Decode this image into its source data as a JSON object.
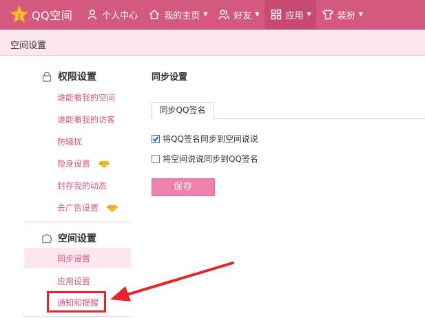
{
  "topbar": {
    "brand": "QQ空间",
    "nav": [
      {
        "label": "个人中心",
        "icon": "person-icon",
        "has_caret": false
      },
      {
        "label": "我的主页",
        "icon": "home-icon",
        "has_caret": true
      },
      {
        "label": "好友",
        "icon": "friends-icon",
        "has_caret": true
      },
      {
        "label": "应用",
        "icon": "apps-grid-icon",
        "has_caret": true,
        "active": true
      },
      {
        "label": "装扮",
        "icon": "tshirt-icon",
        "has_caret": true
      }
    ],
    "caret": "▼"
  },
  "page_header": {
    "title": "空间设置"
  },
  "sidebar": {
    "permissions": {
      "title": "权限设置",
      "icon": "lock-icon",
      "items": [
        {
          "label": "谁能看我的空间"
        },
        {
          "label": "谁能看我的访客"
        },
        {
          "label": "防骚扰"
        },
        {
          "label": "隐身设置",
          "vip_icon": "diamond-icon"
        },
        {
          "label": "封存我的动态"
        },
        {
          "label": "去广告设置",
          "vip_icon": "diamond-icon"
        }
      ]
    },
    "space": {
      "title": "空间设置",
      "icon": "puzzle-icon",
      "items": [
        {
          "label": "同步设置",
          "active": true
        },
        {
          "label": "应用设置"
        },
        {
          "label": "通知和提醒",
          "highlighted": true
        }
      ]
    }
  },
  "main": {
    "title": "同步设置",
    "tab": "同步QQ签名",
    "options": [
      {
        "label": "将QQ签名同步到空间说说",
        "checked": true
      },
      {
        "label": "将空间说说同步到QQ签名",
        "checked": false
      }
    ],
    "save_label": "保存"
  },
  "colors": {
    "topbar": "#d4587f",
    "accent_pink": "#d4587f",
    "save_button": "#ee80ad",
    "annotation_red": "#e8232b"
  }
}
